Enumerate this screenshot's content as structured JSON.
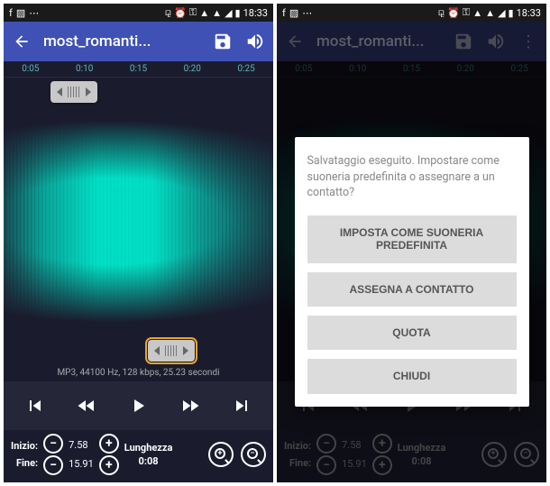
{
  "status": {
    "time": "18:33",
    "icons": [
      "bluetooth",
      "alarm",
      "key",
      "wifi",
      "wifi",
      "signal",
      "battery"
    ],
    "left_icons": [
      "facebook",
      "image",
      "more"
    ]
  },
  "app": {
    "title": "most_romanti...",
    "title_full": "most_romanti..."
  },
  "timeline": {
    "ticks": [
      "0:05",
      "0:10",
      "0:15",
      "0:20",
      "0:25"
    ]
  },
  "info": "MP3, 44100 Hz, 128 kbps, 25.23 secondi",
  "controls": {
    "inizio_label": "Inizio:",
    "fine_label": "Fine:",
    "inizio_value": "7.58",
    "fine_value": "15.91",
    "lunghezza_label": "Lunghezza",
    "lunghezza_value": "0:08"
  },
  "modal": {
    "message": "Salvataggio eseguito. Impostare come suoneria predefinita o assegnare a un contatto?",
    "btn1": "IMPOSTA COME SUONERIA PREDEFINITA",
    "btn2": "ASSEGNA A CONTATTO",
    "btn3": "QUOTA",
    "btn4": "CHIUDI"
  }
}
